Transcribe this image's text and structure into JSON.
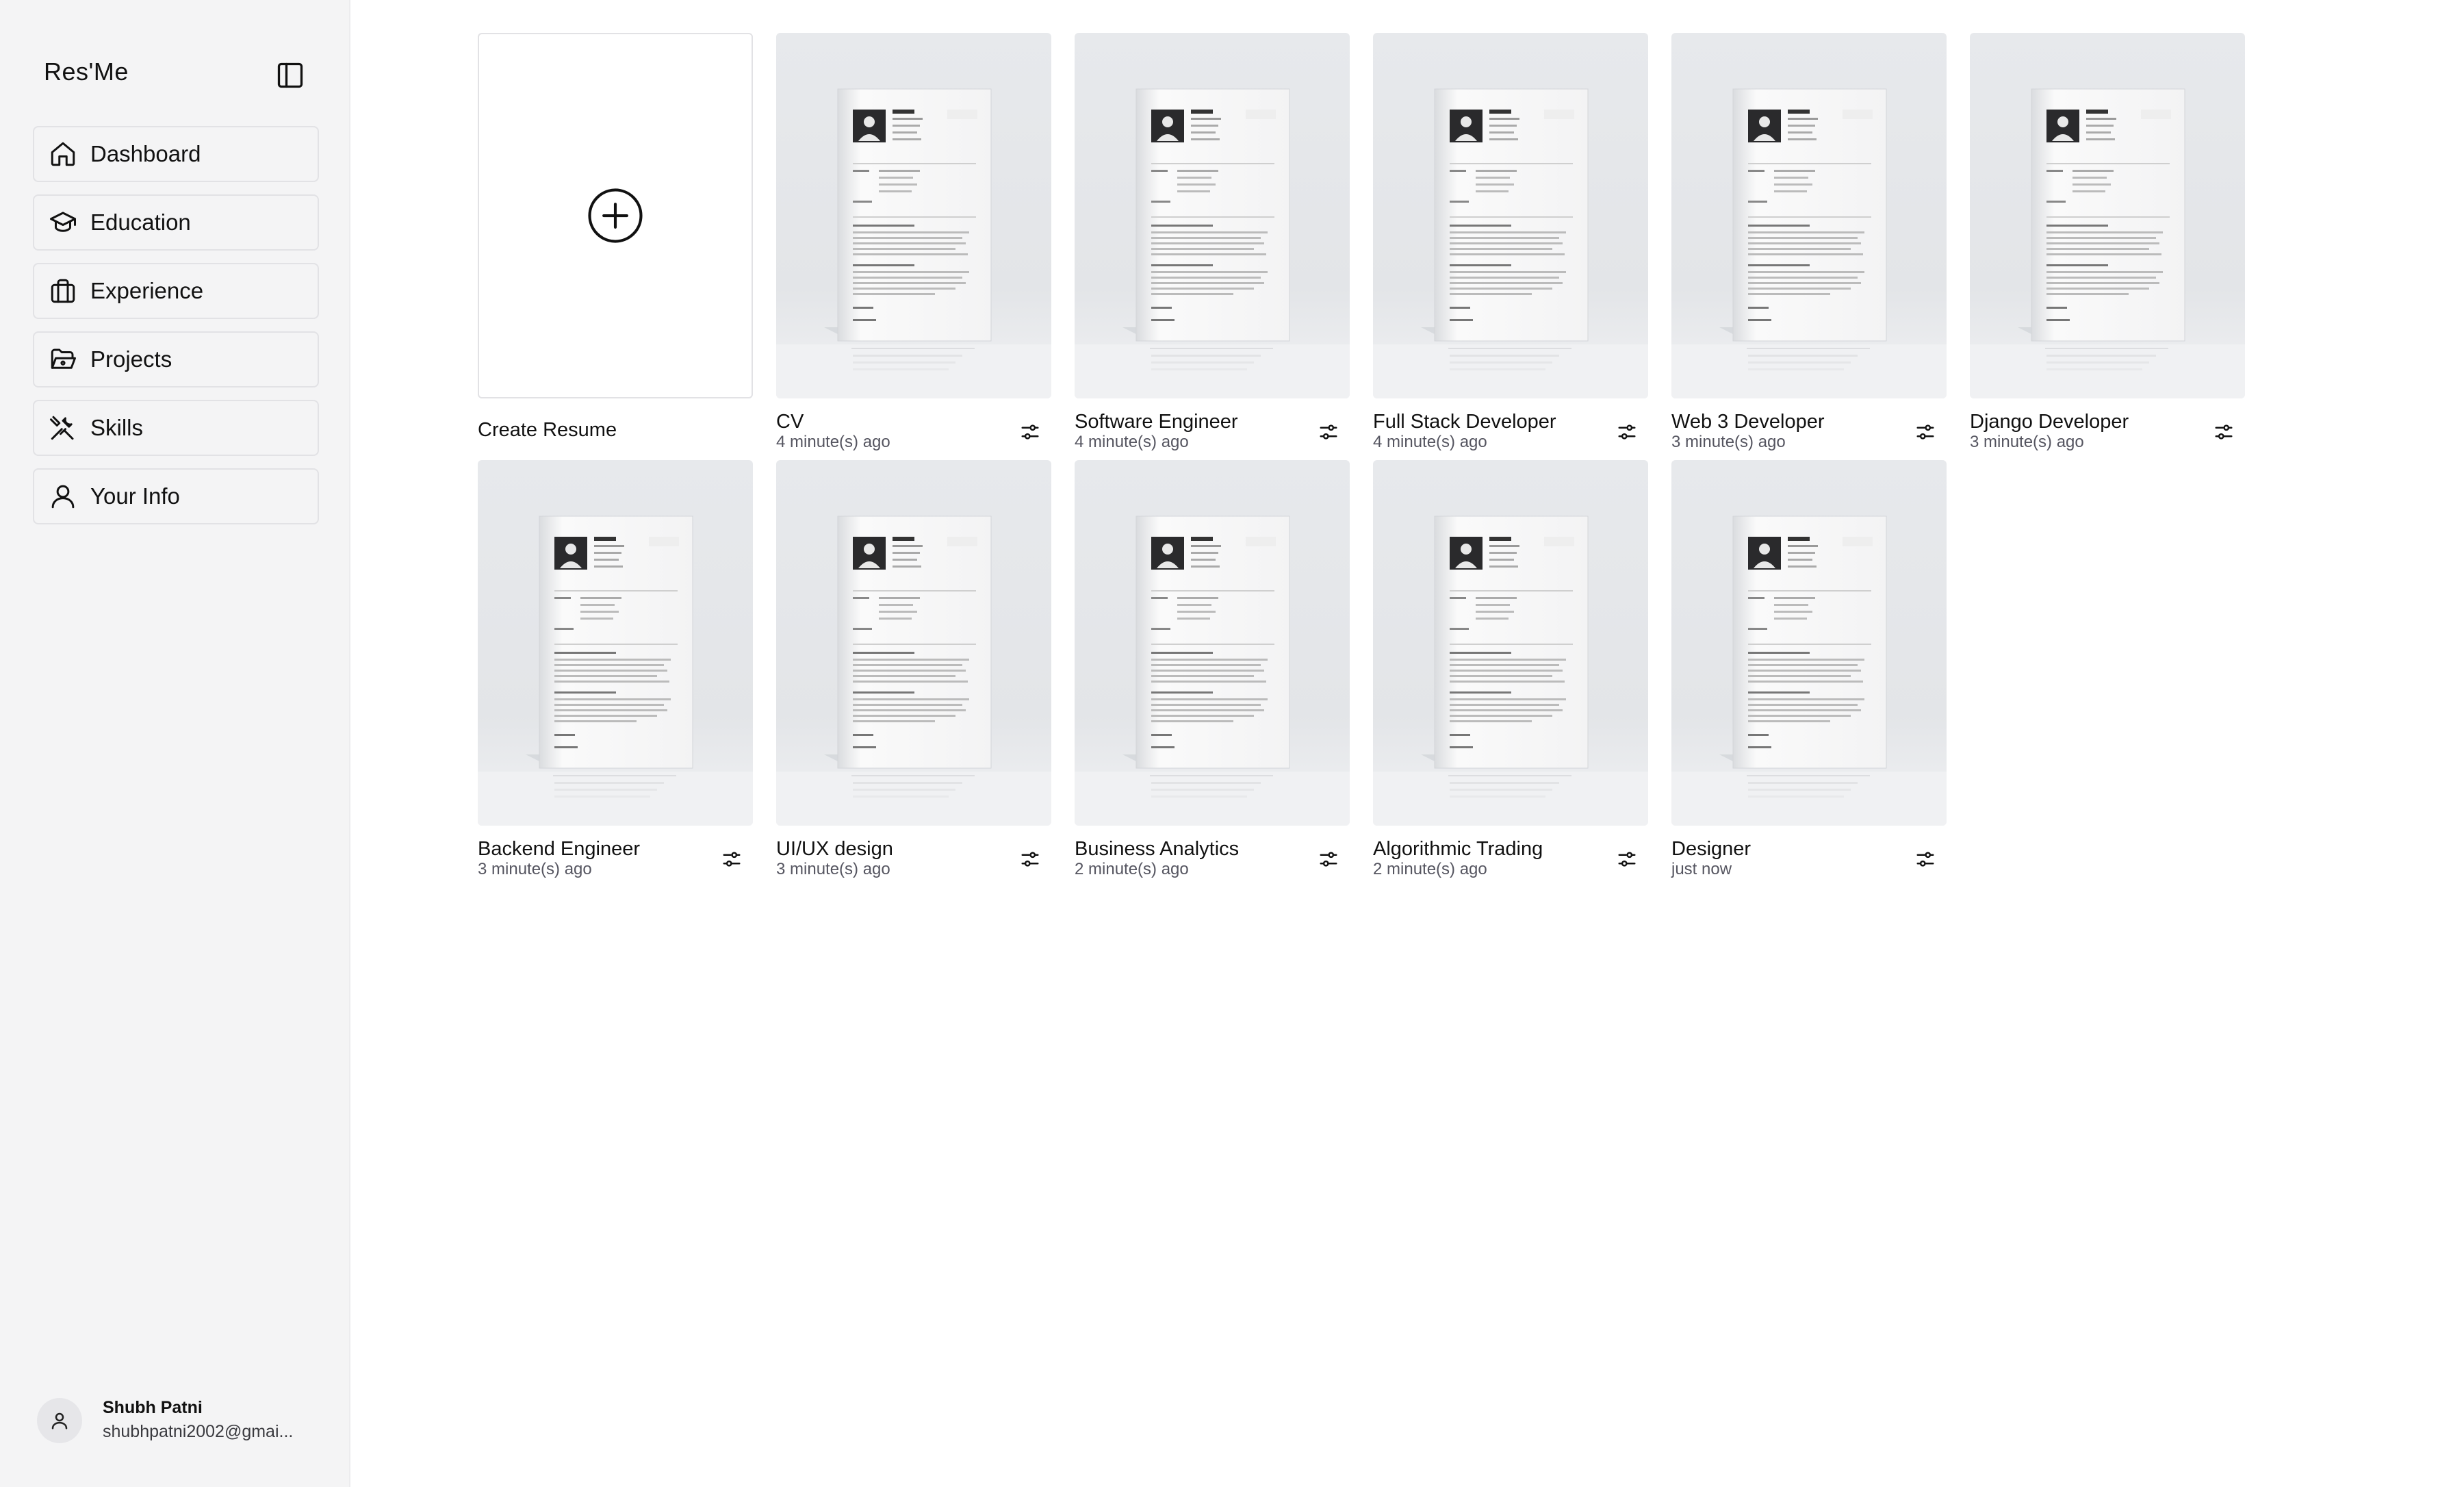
{
  "app": {
    "title": "Res'Me"
  },
  "sidebar": {
    "items": [
      {
        "label": "Dashboard",
        "icon": "home-icon"
      },
      {
        "label": "Education",
        "icon": "graduation-cap-icon"
      },
      {
        "label": "Experience",
        "icon": "briefcase-icon"
      },
      {
        "label": "Projects",
        "icon": "folder-open-icon"
      },
      {
        "label": "Skills",
        "icon": "tools-icon"
      },
      {
        "label": "Your Info",
        "icon": "user-icon"
      }
    ]
  },
  "user": {
    "name": "Shubh Patni",
    "email": "shubhpatni2002@gmai..."
  },
  "create": {
    "label": "Create Resume"
  },
  "resumes": [
    {
      "title": "CV",
      "time": "4 minute(s) ago"
    },
    {
      "title": "Software Engineer",
      "time": "4 minute(s) ago"
    },
    {
      "title": "Full Stack Developer",
      "time": "4 minute(s) ago"
    },
    {
      "title": "Web 3 Developer",
      "time": "3 minute(s) ago"
    },
    {
      "title": "Django Developer",
      "time": "3 minute(s) ago"
    },
    {
      "title": "Backend Engineer",
      "time": "3 minute(s) ago"
    },
    {
      "title": "UI/UX design",
      "time": "3 minute(s) ago"
    },
    {
      "title": "Business Analytics",
      "time": "2 minute(s) ago"
    },
    {
      "title": "Algorithmic Trading",
      "time": "2 minute(s) ago"
    },
    {
      "title": "Designer",
      "time": "just now"
    }
  ]
}
